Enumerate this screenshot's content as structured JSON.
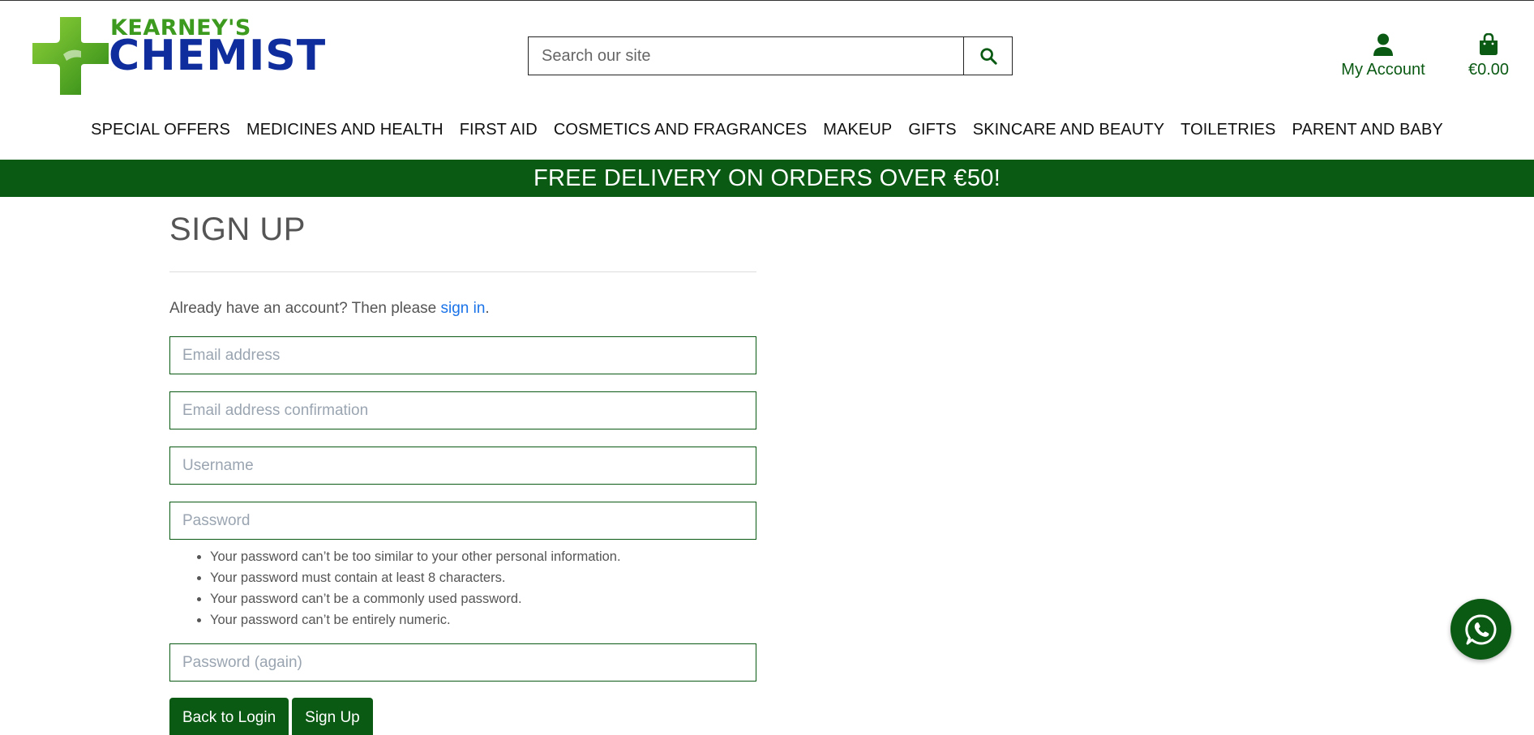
{
  "brand": {
    "name_top": "KEARNEY'S",
    "name_main": "CHEMIST",
    "colors": {
      "green": "#0b5a14",
      "logo_green": "#3c9a1f",
      "logo_blue": "#0f2d9c",
      "link": "#1a73e8"
    }
  },
  "search": {
    "placeholder": "Search our site",
    "icon": "search-icon"
  },
  "account": {
    "label": "My Account",
    "icon": "user-icon"
  },
  "cart": {
    "total": "€0.00",
    "icon": "shopping-bag-icon"
  },
  "nav": {
    "items": [
      "SPECIAL OFFERS",
      "MEDICINES AND HEALTH",
      "FIRST AID",
      "COSMETICS AND FRAGRANCES",
      "MAKEUP",
      "GIFTS",
      "SKINCARE AND BEAUTY",
      "TOILETRIES",
      "PARENT AND BABY"
    ]
  },
  "banner": {
    "text": "FREE DELIVERY ON ORDERS OVER €50!"
  },
  "signup": {
    "title": "SIGN UP",
    "intro_prefix": "Already have an account? Then please ",
    "intro_link": "sign in",
    "intro_suffix": ".",
    "fields": {
      "email": "Email address",
      "email_confirm": "Email address confirmation",
      "username": "Username",
      "password": "Password",
      "password_again": "Password (again)"
    },
    "password_help": [
      "Your password can’t be too similar to your other personal information.",
      "Your password must contain at least 8 characters.",
      "Your password can’t be a commonly used password.",
      "Your password can’t be entirely numeric."
    ],
    "buttons": {
      "back": "Back to Login",
      "submit": "Sign Up"
    }
  },
  "chat": {
    "icon": "whatsapp-icon"
  }
}
